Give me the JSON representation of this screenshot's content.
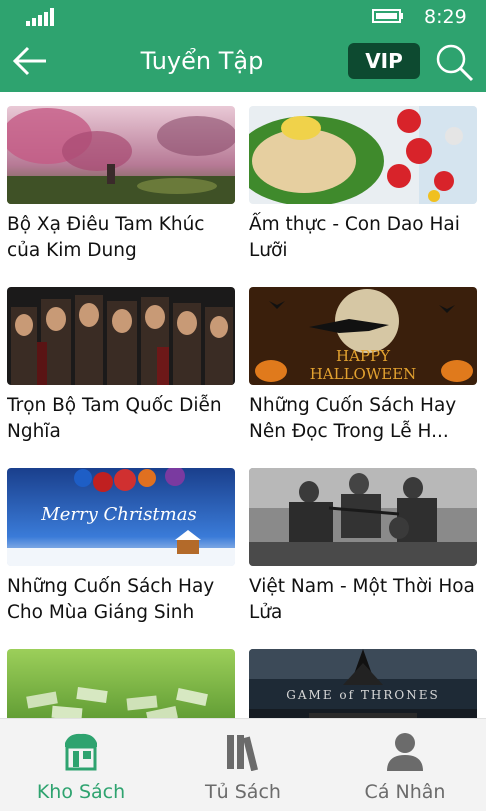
{
  "status_bar": {
    "time": "8:29"
  },
  "header": {
    "title": "Tuyển Tập",
    "vip_label": "VIP"
  },
  "books": [
    {
      "title": "Bộ Xạ Điêu Tam Khúc của Kim Dung"
    },
    {
      "title": "Ẩm thực - Con Dao Hai Lưỡi"
    },
    {
      "title": "Trọn Bộ Tam Quốc Diễn Nghĩa"
    },
    {
      "title": "Những Cuốn Sách Hay Nên Đọc Trong Lễ H..."
    },
    {
      "title": "Những Cuốn Sách Hay Cho Mùa Giáng Sinh"
    },
    {
      "title": "Việt Nam - Một Thời Hoa Lửa"
    },
    {
      "title": ""
    },
    {
      "title": ""
    }
  ],
  "thumb_text": {
    "halloween_1": "HAPPY",
    "halloween_2": "HALLOWEEN",
    "christmas": "Merry Christmas",
    "got": "GAME of THRONES"
  },
  "tabs": [
    {
      "label": "Kho Sách",
      "active": true
    },
    {
      "label": "Tủ Sách",
      "active": false
    },
    {
      "label": "Cá Nhân",
      "active": false
    }
  ],
  "colors": {
    "accent": "#2ea36f",
    "vip_bg": "#0d4a30",
    "inactive": "#6b6b6b"
  }
}
